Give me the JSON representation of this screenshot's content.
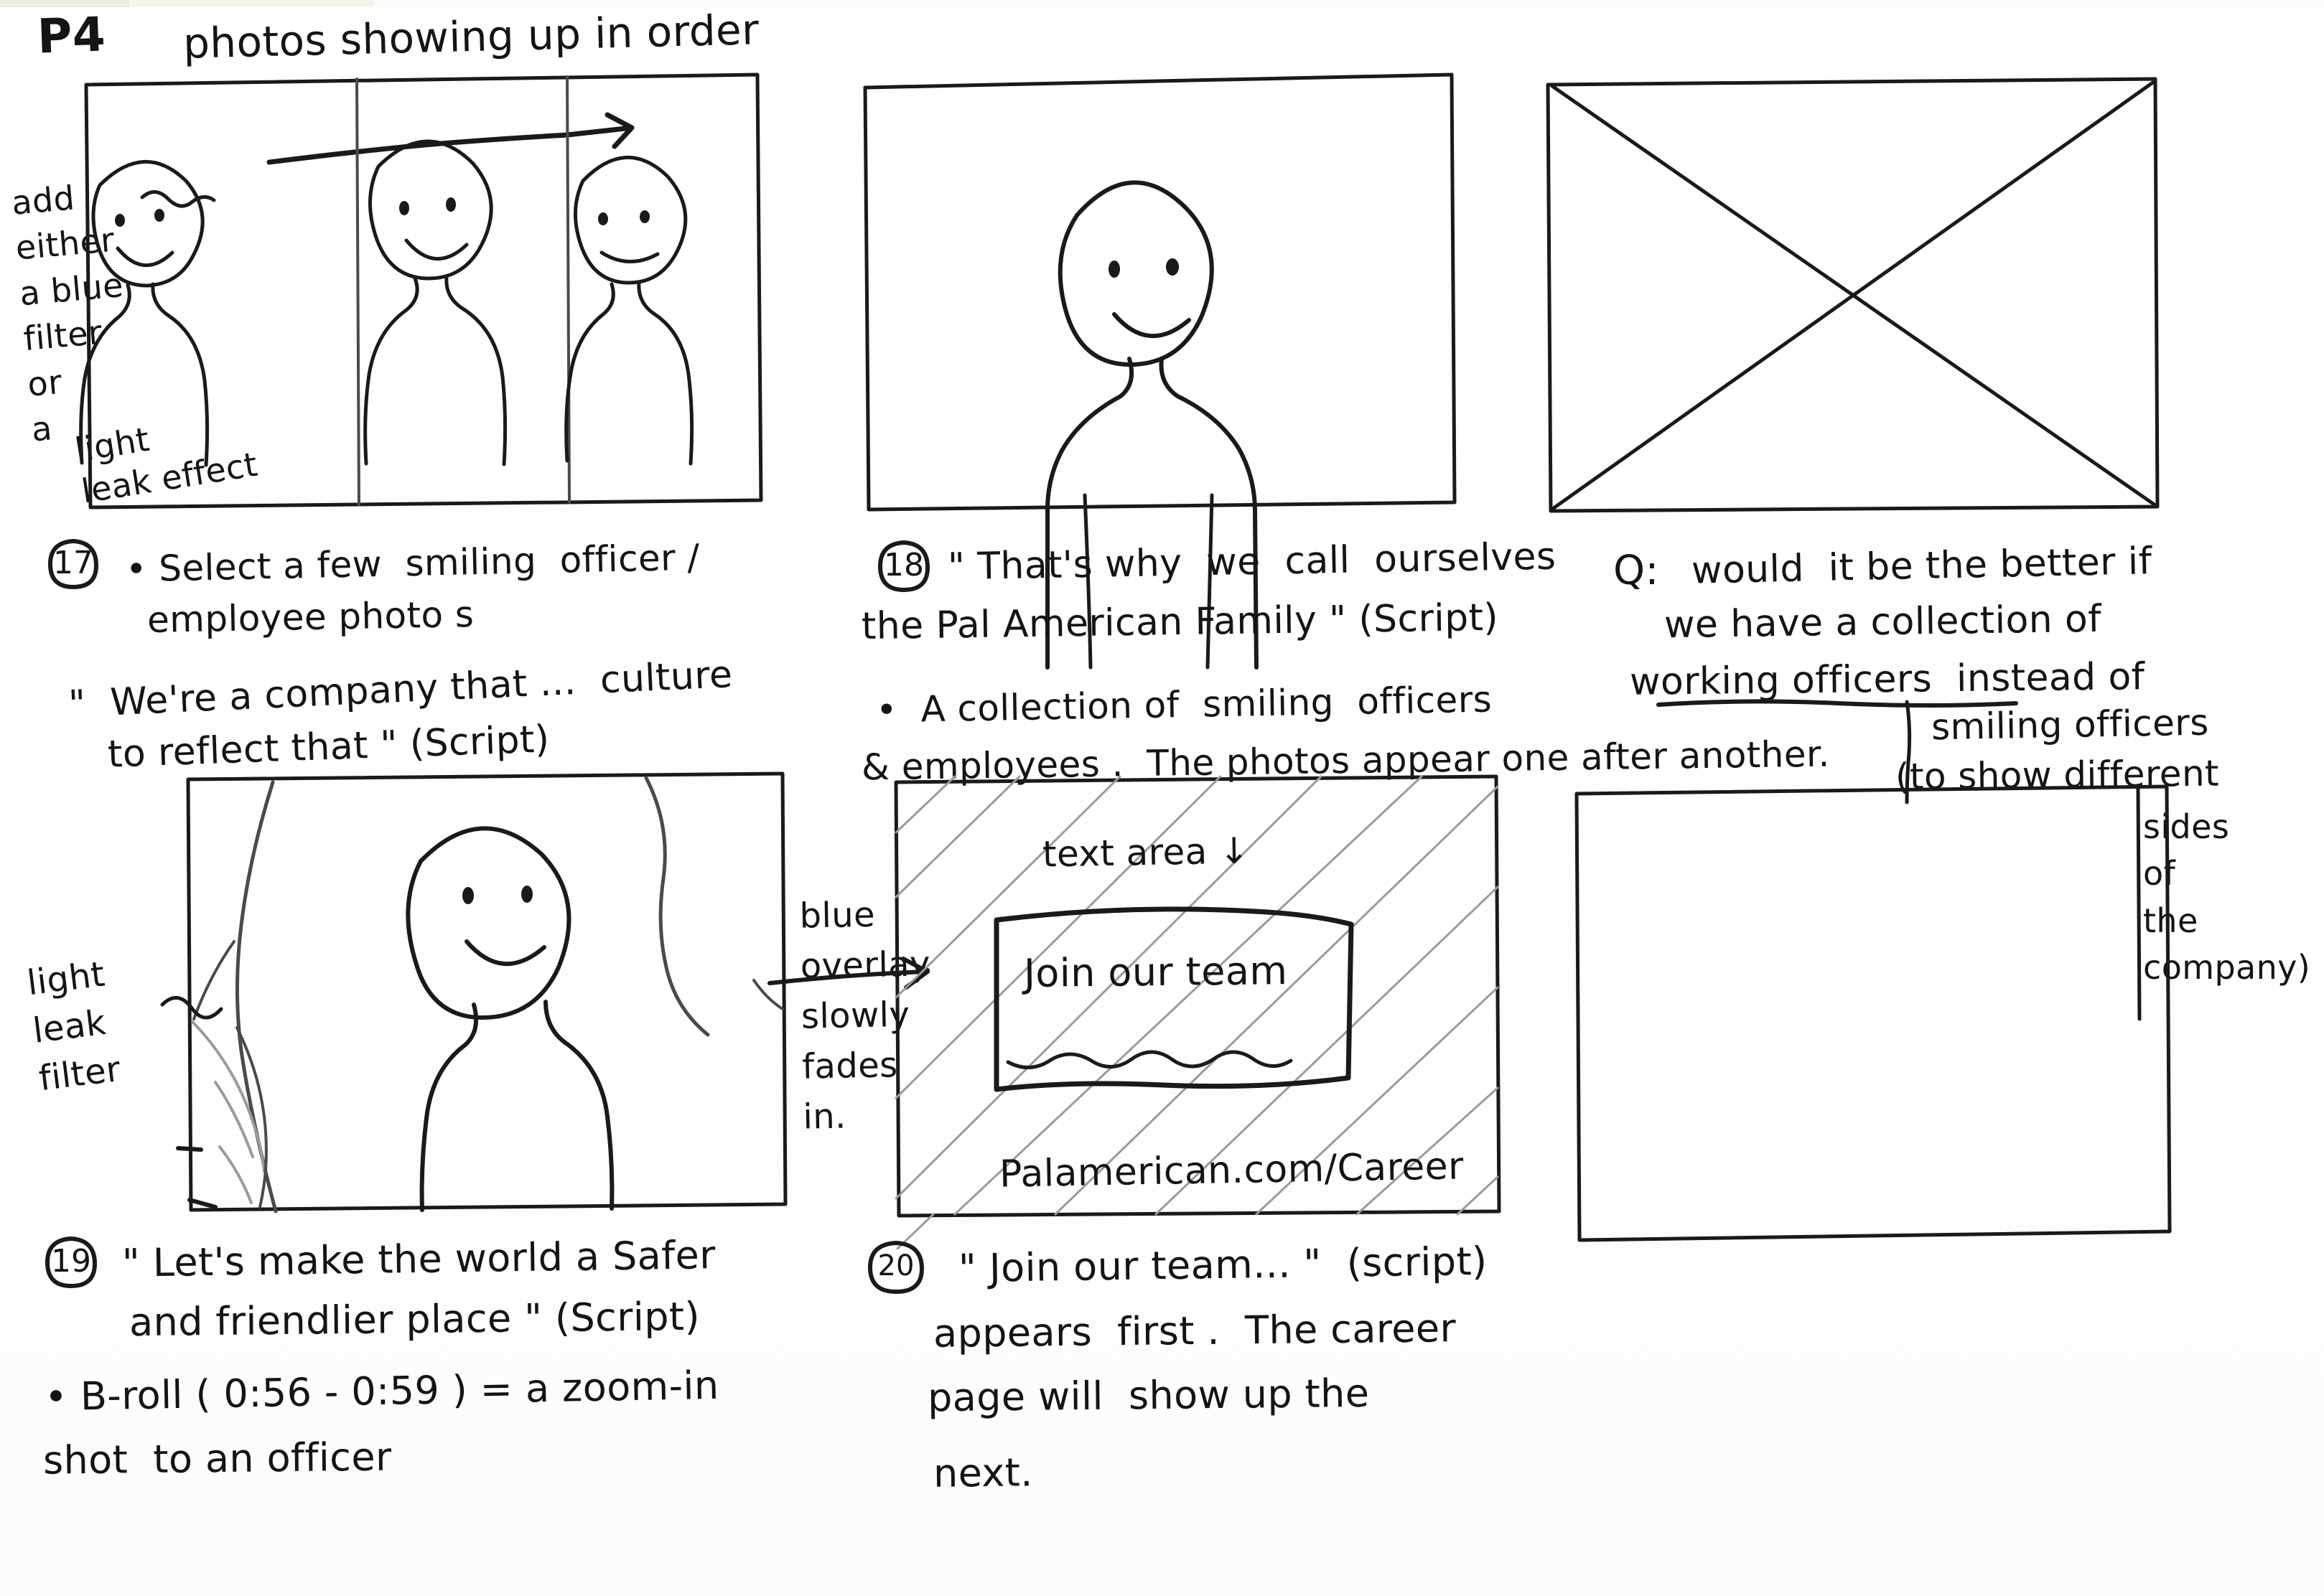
{
  "page": {
    "page_label": "P4",
    "header_note": "photos showing up in order"
  },
  "margin_notes": {
    "top_left": "add\neither\na blue\nfilter\nor\na",
    "top_left_tail": "light\nleak effect",
    "mid_left": "light\nleak\nfilter",
    "mid_center": "blue\noverlay\nslowly\nfades\nin."
  },
  "panels": [
    {
      "id": "panel-17",
      "number": "17",
      "caption_bullet": "• Select a few  smiling  officer /",
      "caption_bullet_line2": "employee photo s",
      "script_line1": "\"  We're a company that ...  culture",
      "script_line2": "to reflect that \" (Script)",
      "frame_type": "three-photo-strip"
    },
    {
      "id": "panel-18",
      "number": "18",
      "script_line1": "\" That's why  we  call  ourselves",
      "script_line2": "the Pal American Family \" (Script)",
      "bullet_line1": "•  A collection of  smiling  officers",
      "bullet_line2": "& employees .  The photos appear one after another.",
      "frame_type": "single-figure"
    },
    {
      "id": "panel-q",
      "number": "Q:",
      "q_line1": "would  it be the better if",
      "q_line2": "we have a collection of",
      "q_line3": "working officers  instead of",
      "q_line4": "smiling officers",
      "q_line5": "(to show different",
      "q_vertical": "sides\nof\nthe\ncompany)",
      "frame_type": "crossed-out"
    },
    {
      "id": "panel-19",
      "number": "19",
      "script_line1": "\" Let's make the world a Safer",
      "script_line2": "and friendlier place \" (Script)",
      "bullet_line1": "• B-roll ( 0:56 - 0:59 ) = a zoom-in",
      "bullet_line2": "shot  to an officer",
      "frame_type": "portrait-light-leak"
    },
    {
      "id": "panel-20",
      "number": "20",
      "script_line1": "\" Join our team... \"  (script)",
      "script_line2": "appears  first .  The career",
      "script_line3": "page will  show up the",
      "script_line4": "next.",
      "frame_type": "blue-overlay-text-card",
      "text_area_label": "text area ↓",
      "cta_text": "Join our team",
      "url_text": "Palamerican.com/Career"
    },
    {
      "id": "panel-21",
      "number": "",
      "frame_type": "empty"
    }
  ],
  "colors": {
    "ink": "#1a1a1a",
    "ink_light": "#4a4a4a",
    "ink_faint": "#9b9b9b",
    "paper": "#fdfdfc"
  }
}
